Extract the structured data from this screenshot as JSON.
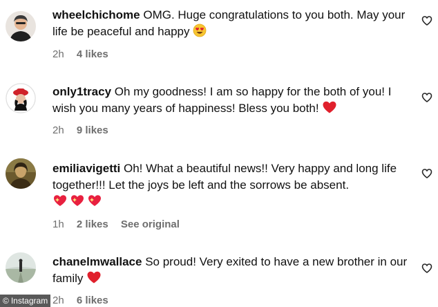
{
  "comments": [
    {
      "username": "wheelchichome",
      "text": "OMG. Huge congratulations to you both. May your life be peaceful and happy",
      "emoji": "heart-eyes-emoji",
      "time": "2h",
      "likes": "4 likes"
    },
    {
      "username": "only1tracy",
      "text": "Oh my goodness! I am so happy for the both of you! I wish you many years of happiness! Bless you both!",
      "emoji": "red-heart-emoji",
      "time": "2h",
      "likes": "9 likes"
    },
    {
      "username": "emiliavigetti",
      "text": "Oh! What a beautiful news!! Very happy and long life together!!! Let the joys be left and the sorrows be absent.",
      "emoji": "sparkling-heart-emoji x3",
      "time": "1h",
      "likes": "2 likes",
      "see_original": "See original"
    },
    {
      "username": "chanelmwallace",
      "text": "So proud! Very exited to have a new brother in our family",
      "emoji": "red-heart-emoji",
      "time": "2h",
      "likes": "6 likes"
    }
  ],
  "credit": {
    "label": "Instagram",
    "icon": "copyright-icon"
  },
  "colors": {
    "meta_gray": "#6e6e6e",
    "heart_red": "#e0202c"
  }
}
